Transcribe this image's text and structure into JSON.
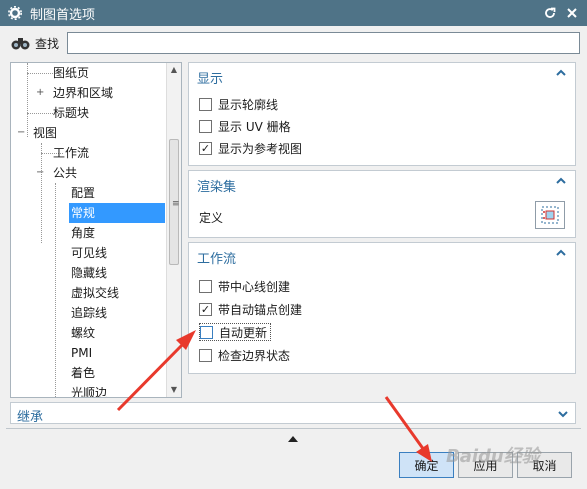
{
  "window": {
    "title": "制图首选项"
  },
  "search": {
    "label": "查找",
    "value": ""
  },
  "tree": {
    "items": [
      {
        "label": "图纸页",
        "depth": 1,
        "expander": ""
      },
      {
        "label": "边界和区域",
        "depth": 1,
        "expander": "+"
      },
      {
        "label": "标题块",
        "depth": 1,
        "expander": ""
      },
      {
        "label": "视图",
        "depth": 0,
        "expander": "−"
      },
      {
        "label": "工作流",
        "depth": 1,
        "expander": ""
      },
      {
        "label": "公共",
        "depth": 1,
        "expander": "−"
      },
      {
        "label": "配置",
        "depth": 2,
        "expander": ""
      },
      {
        "label": "常规",
        "depth": 2,
        "expander": "",
        "selected": true
      },
      {
        "label": "角度",
        "depth": 2,
        "expander": ""
      },
      {
        "label": "可见线",
        "depth": 2,
        "expander": ""
      },
      {
        "label": "隐藏线",
        "depth": 2,
        "expander": ""
      },
      {
        "label": "虚拟交线",
        "depth": 2,
        "expander": ""
      },
      {
        "label": "追踪线",
        "depth": 2,
        "expander": ""
      },
      {
        "label": "螺纹",
        "depth": 2,
        "expander": ""
      },
      {
        "label": "PMI",
        "depth": 2,
        "expander": ""
      },
      {
        "label": "着色",
        "depth": 2,
        "expander": ""
      },
      {
        "label": "光顺边",
        "depth": 2,
        "expander": ""
      }
    ]
  },
  "display_panel": {
    "header": "显示",
    "options": [
      {
        "label": "显示轮廓线",
        "checked": false
      },
      {
        "label": "显示 UV 栅格",
        "checked": false
      },
      {
        "label": "显示为参考视图",
        "checked": true
      }
    ]
  },
  "render_panel": {
    "header": "渲染集",
    "define_label": "定义"
  },
  "workflow_panel": {
    "header": "工作流",
    "options": [
      {
        "label": "带中心线创建",
        "checked": false
      },
      {
        "label": "带自动锚点创建",
        "checked": true
      },
      {
        "label": "自动更新",
        "checked": false
      },
      {
        "label": "检查边界状态",
        "checked": false
      }
    ]
  },
  "inherit": {
    "label": "继承"
  },
  "buttons": {
    "ok": "确定",
    "apply": "应用",
    "cancel": "取消"
  },
  "watermark": "Baidu经验",
  "colors": {
    "titlebar": "#4f7387",
    "accent": "#2d6d9f",
    "selection": "#3399ff",
    "annotation_arrow": "#e8392c"
  }
}
